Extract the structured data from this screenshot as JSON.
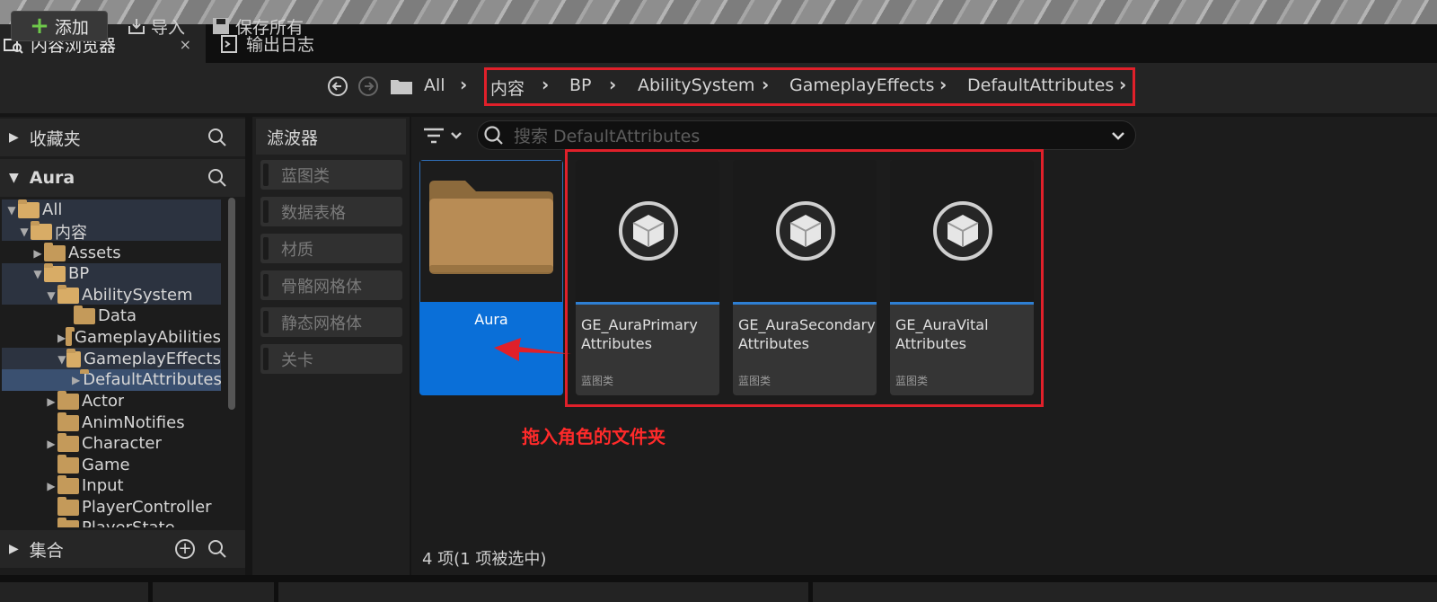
{
  "tabs": [
    {
      "label": "内容浏览器",
      "close": "×"
    },
    {
      "label": "输出日志"
    }
  ],
  "toolbar": {
    "add_label": "添加",
    "import_label": "导入",
    "save_all_label": "保存所有",
    "path": [
      "All",
      "内容",
      "BP",
      "AbilitySystem",
      "GameplayEffects",
      "DefaultAttributes"
    ]
  },
  "left_panel": {
    "favorites_label": "收藏夹",
    "project_label": "Aura",
    "collections_label": "集合",
    "tree": [
      {
        "label": "All"
      },
      {
        "label": "内容"
      },
      {
        "label": "Assets"
      },
      {
        "label": "BP"
      },
      {
        "label": "AbilitySystem"
      },
      {
        "label": "Data"
      },
      {
        "label": "GameplayAbilities"
      },
      {
        "label": "GameplayEffects"
      },
      {
        "label": "DefaultAttributes"
      },
      {
        "label": "Actor"
      },
      {
        "label": "AnimNotifies"
      },
      {
        "label": "Character"
      },
      {
        "label": "Game"
      },
      {
        "label": "Input"
      },
      {
        "label": "PlayerController"
      },
      {
        "label": "PlayerState"
      }
    ]
  },
  "filters": {
    "title": "滤波器",
    "items": [
      "蓝图类",
      "数据表格",
      "材质",
      "骨骼网格体",
      "静态网格体",
      "关卡"
    ]
  },
  "search": {
    "placeholder": "搜索 DefaultAttributes"
  },
  "assets": [
    {
      "name": "Aura",
      "kind": "folder"
    },
    {
      "name": "GE_AuraPrimary Attributes",
      "type": "蓝图类"
    },
    {
      "name": "GE_AuraSecondary Attributes",
      "type": "蓝图类"
    },
    {
      "name": "GE_AuraVital Attributes",
      "type": "蓝图类"
    }
  ],
  "annotation": "拖入角色的文件夹",
  "status": "4 项(1 项被选中)",
  "colors": {
    "accent": "#2e7fd3",
    "selection": "#0a6fd8",
    "annotation": "#e0202a"
  }
}
